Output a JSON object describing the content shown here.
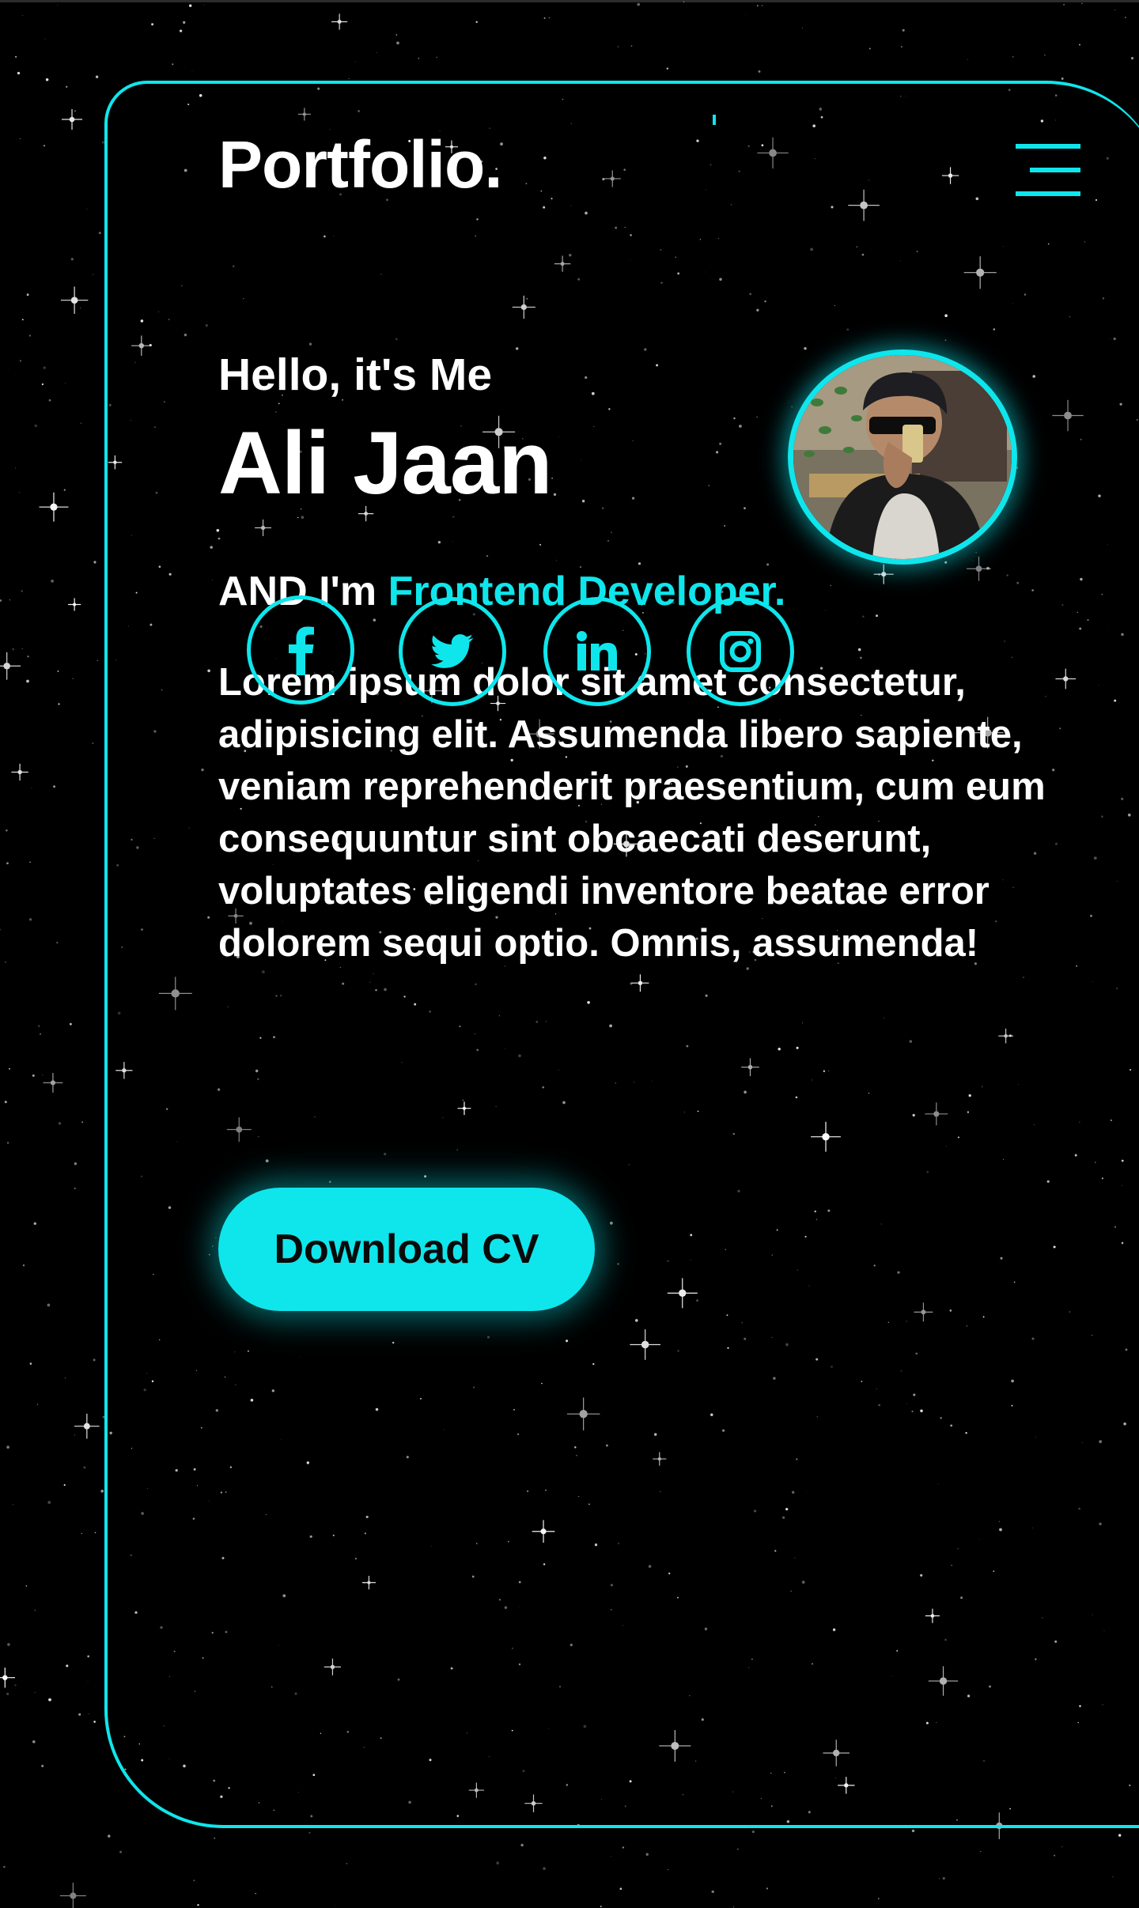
{
  "brand": {
    "logo": "Portfolio."
  },
  "nav": {
    "menu_icon": "hamburger-menu-icon"
  },
  "hero": {
    "greeting": "Hello, it's Me",
    "name": "Ali Jaan",
    "role_prefix": "AND I'm",
    "role": "Frontend Developer.",
    "bio": "Lorem ipsum dolor sit amet consectetur, adipisicing elit. Assumenda libero sapiente, veniam reprehenderit praesentium, cum eum consequuntur sint obcaecati deserunt, voluptates eligendi inventore beatae error dolorem sequi optio. Omnis, assumenda!",
    "avatar_icon": "profile-photo"
  },
  "social": [
    {
      "name": "facebook",
      "icon": "facebook-icon"
    },
    {
      "name": "twitter",
      "icon": "twitter-icon"
    },
    {
      "name": "linkedin",
      "icon": "linkedin-icon"
    },
    {
      "name": "instagram",
      "icon": "instagram-icon"
    }
  ],
  "cta": {
    "download_label": "Download CV"
  },
  "colors": {
    "accent": "#0ee6ec",
    "background": "#000000",
    "text": "#ffffff"
  }
}
